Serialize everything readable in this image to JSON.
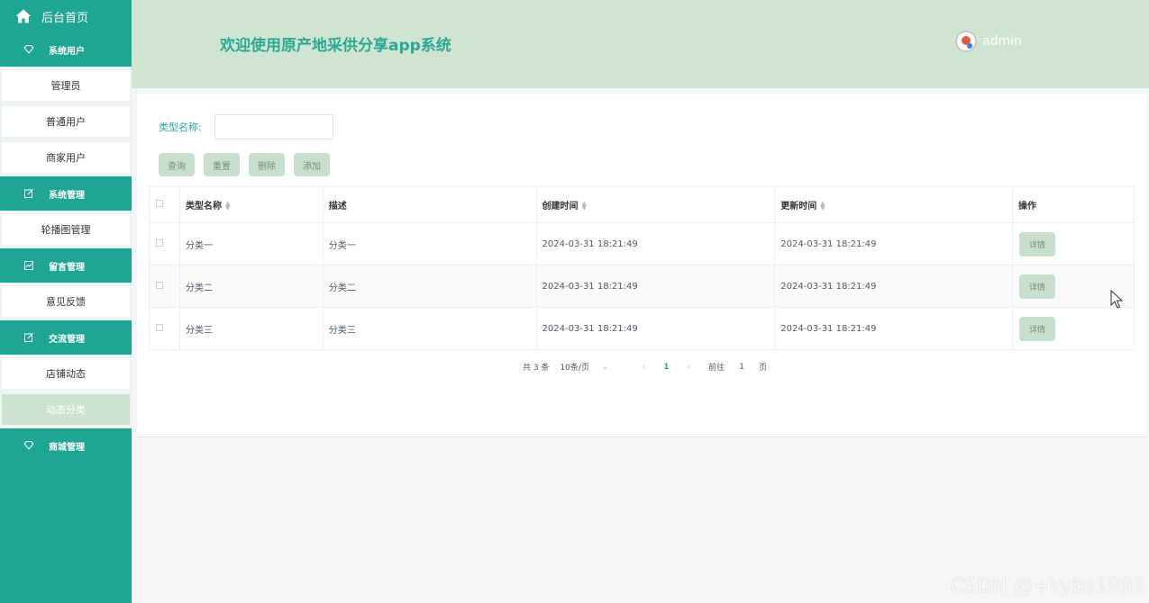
{
  "sidebar": {
    "home_label": "后台首页",
    "groups": [
      {
        "label": "系统用户",
        "icon": "diamond-icon",
        "items": [
          "管理员",
          "普通用户",
          "商家用户"
        ]
      },
      {
        "label": "系统管理",
        "icon": "edit-icon",
        "items": [
          "轮播图管理"
        ]
      },
      {
        "label": "留言管理",
        "icon": "chart-icon",
        "items": [
          "意见反馈"
        ]
      },
      {
        "label": "交流管理",
        "icon": "edit-icon",
        "items": [
          "店铺动态",
          "动态分类"
        ]
      },
      {
        "label": "商城管理",
        "icon": "diamond-icon",
        "items": []
      }
    ],
    "active_item": "动态分类"
  },
  "header": {
    "title": "欢迎使用原产地采供分享app系统",
    "username": "admin"
  },
  "search": {
    "label": "类型名称:",
    "value": ""
  },
  "buttons": {
    "query": "查询",
    "reset": "重置",
    "delete": "删除",
    "add": "添加"
  },
  "table": {
    "columns": [
      "类型名称",
      "描述",
      "创建时间",
      "更新时间",
      "操作"
    ],
    "rows": [
      {
        "name": "分类一",
        "desc": "分类一",
        "created": "2024-03-31 18:21:49",
        "updated": "2024-03-31 18:21:49",
        "action": "详情"
      },
      {
        "name": "分类二",
        "desc": "分类二",
        "created": "2024-03-31 18:21:49",
        "updated": "2024-03-31 18:21:49",
        "action": "详情"
      },
      {
        "name": "分类三",
        "desc": "分类三",
        "created": "2024-03-31 18:21:49",
        "updated": "2024-03-31 18:21:49",
        "action": "详情"
      }
    ]
  },
  "pagination": {
    "total": "共 3 条",
    "page_size": "10条/页",
    "current": "1",
    "goto_label": "前往",
    "goto_value": "1",
    "page_unit": "页"
  },
  "watermark": "CSDN @+kybs1991",
  "colors": {
    "sidebar": "#1fa594",
    "header": "#cfe4d1",
    "accent": "#2ba896",
    "button": "#c9dfcd"
  }
}
